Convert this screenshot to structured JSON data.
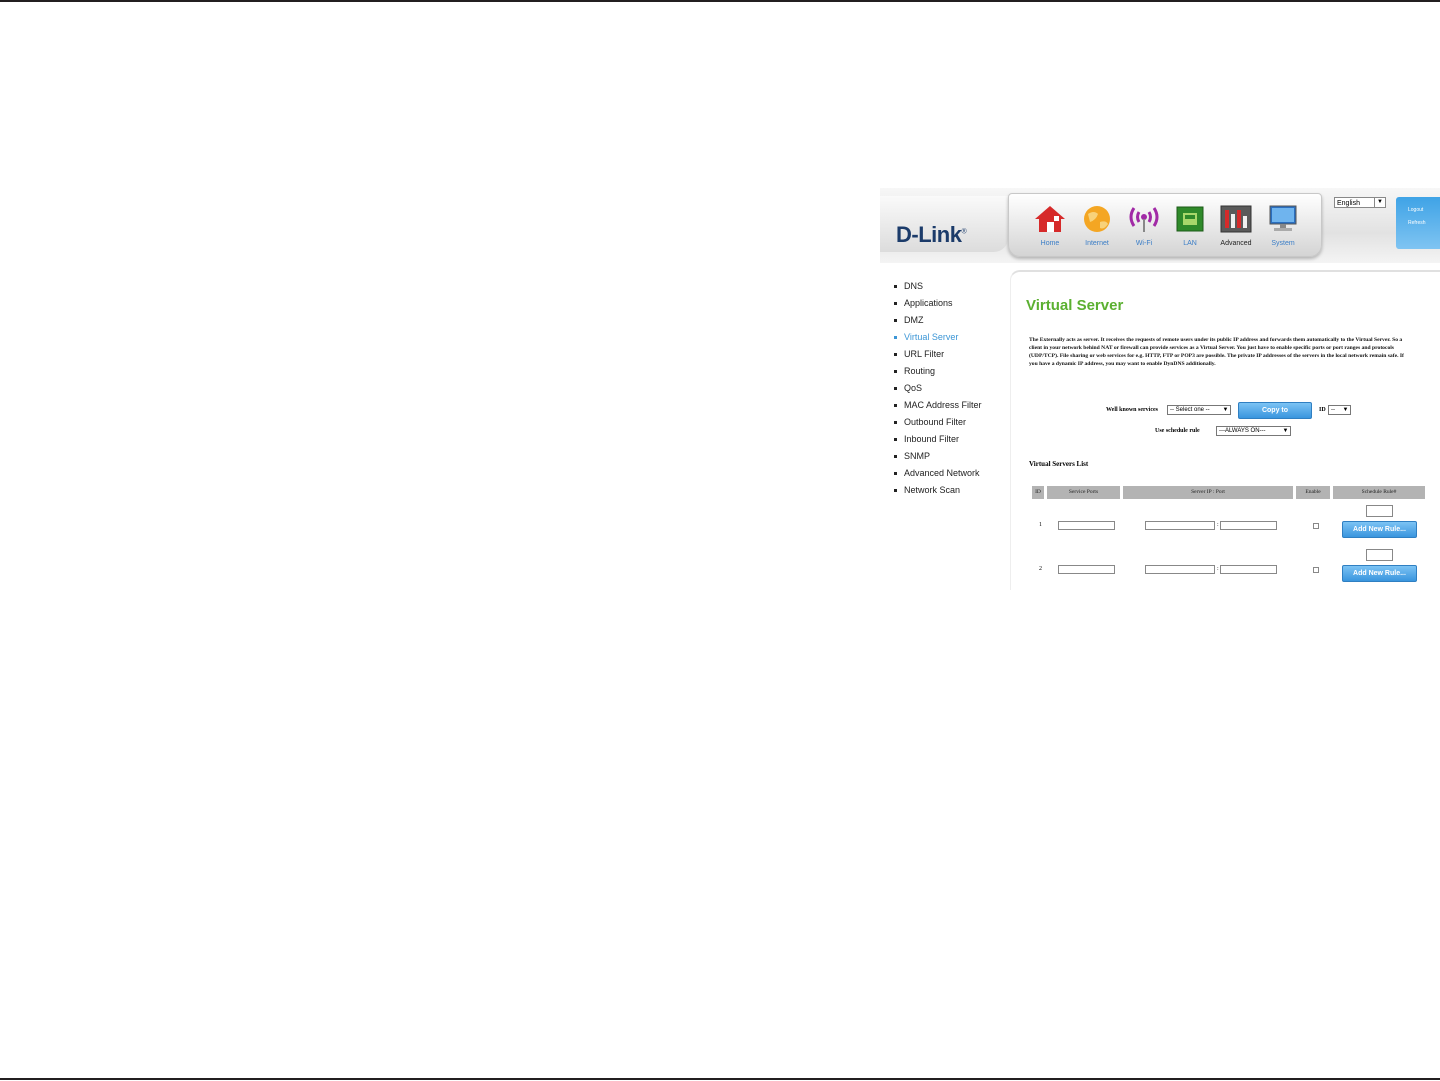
{
  "header": {
    "logo": "D-Link",
    "logo_mark": "®",
    "nav": [
      {
        "label": "Home",
        "icon": "home-icon"
      },
      {
        "label": "Internet",
        "icon": "globe-icon"
      },
      {
        "label": "Wi-Fi",
        "icon": "wifi-antenna-icon"
      },
      {
        "label": "LAN",
        "icon": "lan-port-icon"
      },
      {
        "label": "Advanced",
        "icon": "advanced-tools-icon"
      },
      {
        "label": "System",
        "icon": "computer-icon"
      }
    ],
    "active_nav": "Advanced",
    "language": "English",
    "logout": "Logout",
    "refresh": "Refresh"
  },
  "menu": {
    "items": [
      "DNS",
      "Applications",
      "DMZ",
      "Virtual Server",
      "URL Filter",
      "Routing",
      "QoS",
      "MAC Address Filter",
      "Outbound Filter",
      "Inbound Filter",
      "SNMP",
      "Advanced Network",
      "Network Scan"
    ],
    "active": "Virtual Server"
  },
  "content": {
    "title": "Virtual Server",
    "description": "The Externally acts as server. It receives the requests of remote users under its public IP address and forwards them automatically to the Virtual Server. So a client in your network behind NAT or firewall can provide services as a Virtual Server. You just have to enable specific ports or port ranges and protocols (UDP/TCP). File sharing or web services for e.g. HTTP, FTP or POP3 are possible. The private IP addresses of the servers in the local network remain safe. If you have a dynamic IP address, you may want to enable DynDNS additionally.",
    "well_known_label": "Well known services",
    "well_known_value": "-- Select one --",
    "copy_button": "Copy to",
    "id_label": "ID",
    "id_value": "--",
    "schedule_label": "Use schedule rule",
    "schedule_value": "---ALWAYS ON---",
    "list_title": "Virtual Servers List",
    "columns": [
      "ID",
      "Service Ports",
      "Server IP : Port",
      "Enable",
      "Schedule Rule#"
    ],
    "rows": [
      {
        "id": "1",
        "separator": ":",
        "button": "Add New Rule..."
      },
      {
        "id": "2",
        "separator": ":",
        "button": "Add New Rule..."
      }
    ]
  },
  "colors": {
    "title_green": "#5bb031",
    "link_blue": "#3c96d6",
    "button_blue": "#3a95de",
    "header_gray": "#b3b3b3"
  }
}
